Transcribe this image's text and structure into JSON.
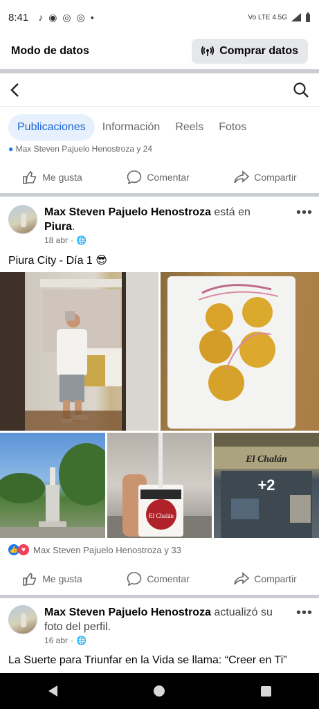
{
  "status_bar": {
    "time": "8:41",
    "icons": [
      "tiktok-icon",
      "notification-icon",
      "chrome-icon",
      "chrome-icon",
      "dot-icon"
    ],
    "network": "Vo LTE 4.5G",
    "signal_icon": "signal-icon",
    "battery_icon": "battery-icon"
  },
  "data_mode": {
    "title": "Modo de datos",
    "buy_label": "Comprar datos",
    "buy_icon": "broadcast-icon"
  },
  "nav": {
    "back_icon": "back-arrow-icon",
    "search_icon": "search-icon"
  },
  "tabs": [
    {
      "label": "Publicaciones",
      "active": true
    },
    {
      "label": "Información",
      "active": false
    },
    {
      "label": "Reels",
      "active": false
    },
    {
      "label": "Fotos",
      "active": false
    }
  ],
  "previous_post": {
    "reactions_text": "Max Steven Pajuelo Henostroza y 24"
  },
  "actions": {
    "like": "Me gusta",
    "comment": "Comentar",
    "share": "Compartir"
  },
  "posts": [
    {
      "author": "Max Steven Pajuelo Henostroza",
      "action_text": "está en",
      "place": "Piura",
      "date": "18 abr",
      "caption": "Piura City - Día 1 😎",
      "photos": [
        "selfie-mirror-photo",
        "food-plate-photo",
        "plaza-monument-photo",
        "drink-cup-photo",
        "restaurant-storefront-photo"
      ],
      "photo_cup_text": "El Chalán",
      "photo_store_text": "El Chalán",
      "more_photos": "+2",
      "reactions_text": "Max Steven Pajuelo Henostroza y 33"
    },
    {
      "author": "Max Steven Pajuelo Henostroza",
      "action_text": "actualizó su foto del perfil.",
      "date": "16 abr",
      "caption": "La Suerte para Triunfar en la Vida se llama: “Creer en Ti”"
    }
  ],
  "colors": {
    "accent": "#1b64d6",
    "tab_active_bg": "#e7f0fd",
    "like_blue": "#1877f2",
    "love_red": "#f33e58",
    "separator": "#c9ccd1"
  }
}
